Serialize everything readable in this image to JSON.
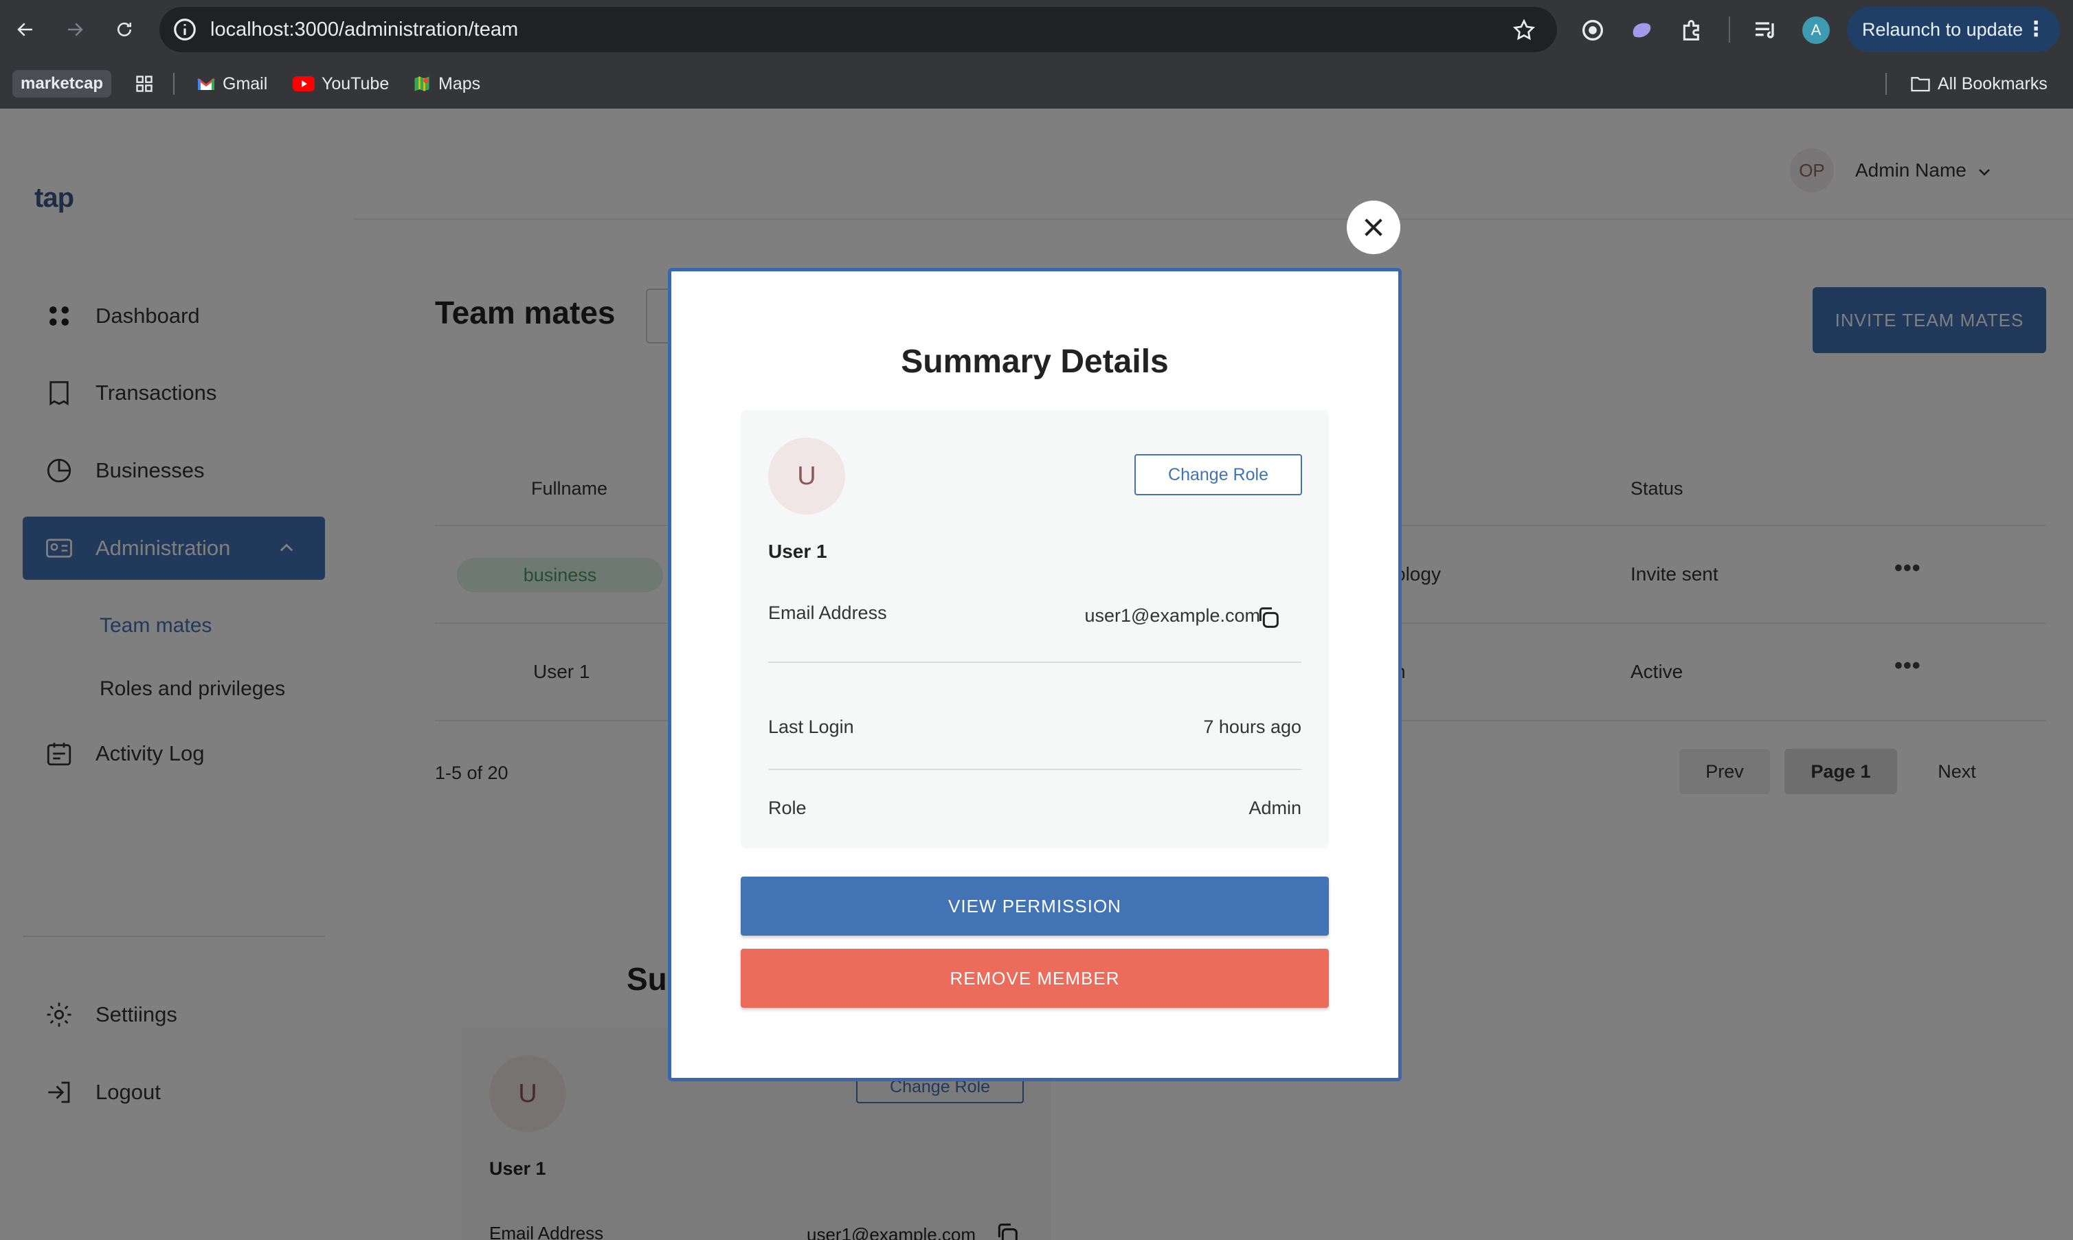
{
  "browser": {
    "url": "localhost:3000/administration/team",
    "relaunch_label": "Relaunch to update",
    "profile_initial": "A",
    "bookmarks": {
      "folder_chip": "marketcap",
      "items": [
        "Gmail",
        "YouTube",
        "Maps"
      ],
      "all_bookmarks": "All Bookmarks"
    }
  },
  "app": {
    "logo": "tap",
    "header": {
      "avatar_initials": "OP",
      "user_name": "Admin Name"
    },
    "sidebar": {
      "items": [
        {
          "label": "Dashboard",
          "icon": "grid-icon"
        },
        {
          "label": "Transactions",
          "icon": "receipt-icon"
        },
        {
          "label": "Businesses",
          "icon": "pie-chart-icon"
        },
        {
          "label": "Administration",
          "icon": "id-card-icon"
        }
      ],
      "sub_items": [
        "Team mates",
        "Roles and privileges"
      ],
      "activity_log": "Activity Log",
      "settings": "Settiings",
      "logout": "Logout"
    },
    "page_title": "Team mates",
    "invite_button": "INVITE TEAM MATES",
    "table": {
      "headers": {
        "fullname": "Fullname",
        "status": "Status"
      },
      "rows": [
        {
          "fullname_tag": "business",
          "partial": "ology",
          "status": "Invite sent"
        },
        {
          "fullname": "User 1",
          "partial": "n",
          "status": "Active"
        }
      ],
      "more_label": "•••"
    },
    "pagination": {
      "count": "1-5 of 20",
      "prev": "Prev",
      "page": "Page 1",
      "next": "Next"
    },
    "background_summary": {
      "title_partial": "Su",
      "avatar": "U",
      "change_role": "Change Role",
      "user": "User 1",
      "email_label": "Email Address",
      "email_value": "user1@example.com"
    }
  },
  "modal": {
    "title": "Summary Details",
    "avatar": "U",
    "change_role": "Change Role",
    "user_name": "User 1",
    "email_label": "Email Address",
    "email_value": "user1@example.com",
    "last_login_label": "Last Login",
    "last_login_value": "7 hours ago",
    "role_label": "Role",
    "role_value": "Admin",
    "view_permission": "VIEW PERMISSION",
    "remove_member": "REMOVE MEMBER"
  },
  "colors": {
    "primary": "#4273b4",
    "danger": "#ec6c5b",
    "modal_border": "#3d67ad",
    "tag_green": "#4a9d63"
  }
}
